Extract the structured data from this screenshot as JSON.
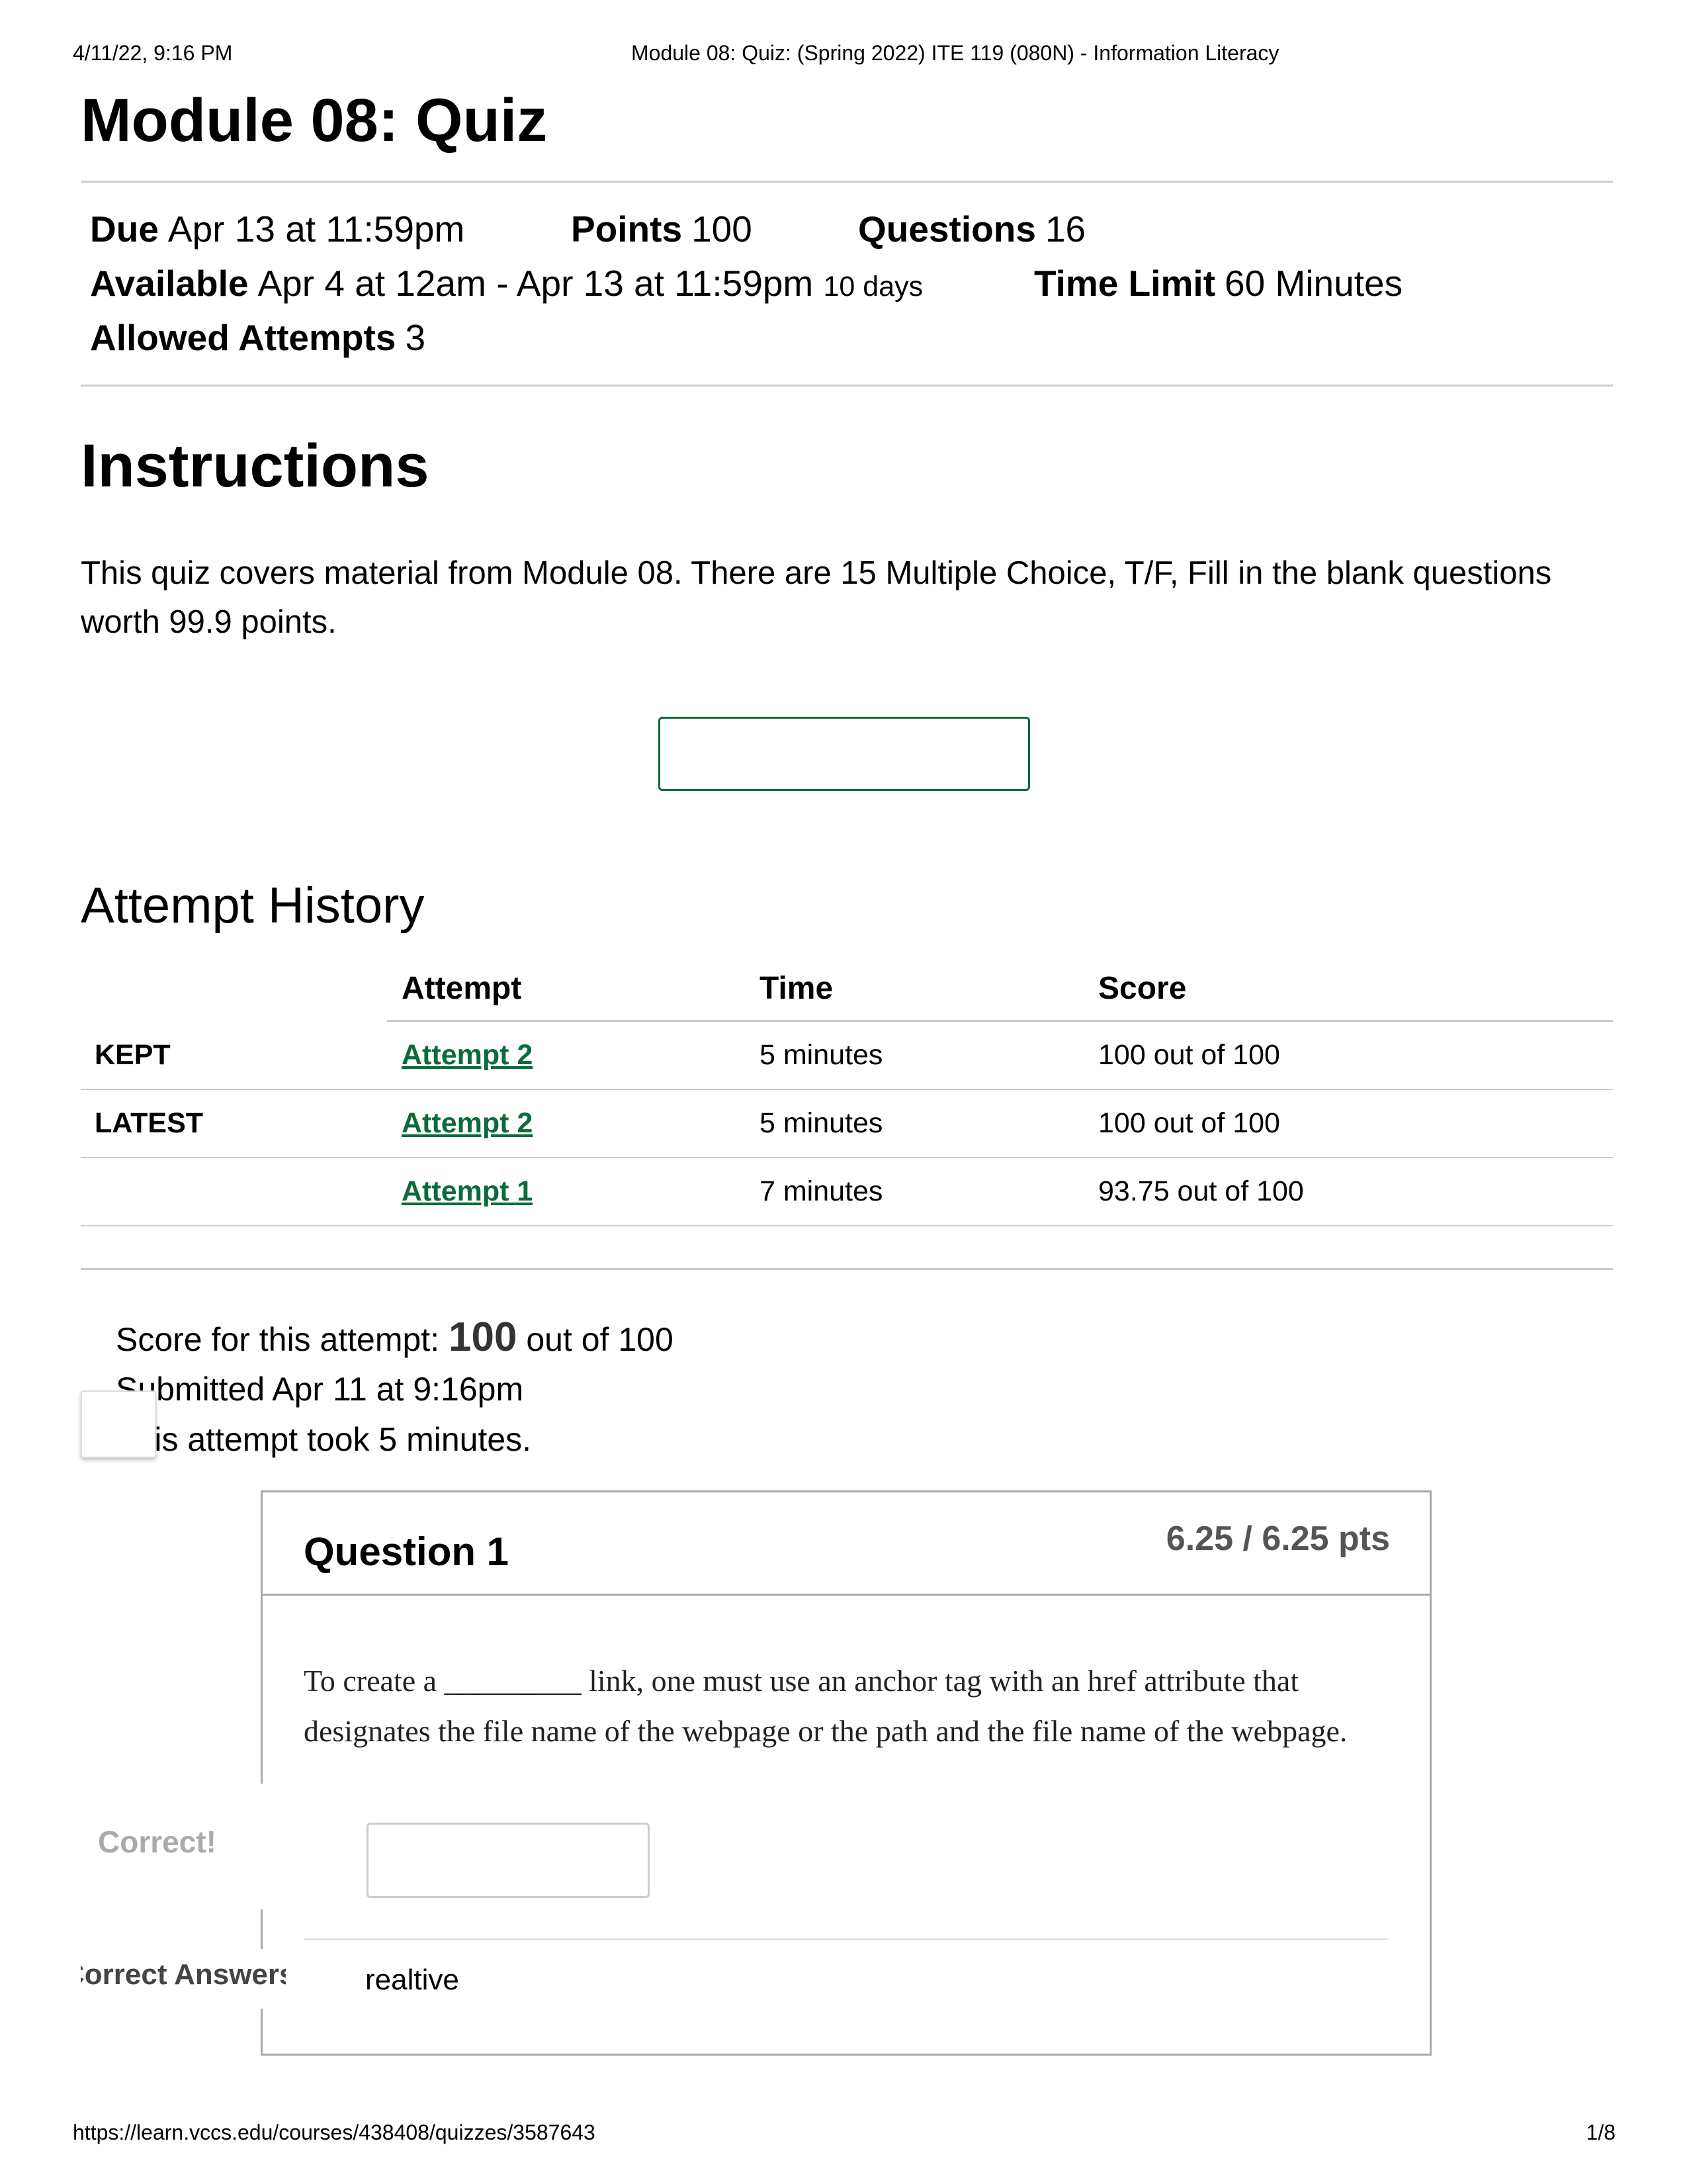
{
  "print_header": {
    "datetime": "4/11/22, 9:16 PM",
    "page_title": "Module 08: Quiz: (Spring 2022) ITE 119 (080N) - Information Literacy"
  },
  "quiz": {
    "title": "Module 08: Quiz",
    "due_label": "Due",
    "due_value": "Apr 13 at 11:59pm",
    "points_label": "Points",
    "points_value": "100",
    "questions_label": "Questions",
    "questions_value": "16",
    "available_label": "Available",
    "available_value": "Apr 4 at 12am - Apr 13 at 11:59pm",
    "available_days": "10 days",
    "time_limit_label": "Time Limit",
    "time_limit_value": "60 Minutes",
    "attempts_label": "Allowed Attempts",
    "attempts_value": "3"
  },
  "instructions": {
    "heading": "Instructions",
    "line1": "This quiz covers material from Module 08. There are 15 Multiple Choice, T/F, Fill in the blank questions",
    "line2": "worth 99.9 points."
  },
  "history": {
    "heading": "Attempt History",
    "columns": [
      "Attempt",
      "Time",
      "Score"
    ],
    "rows": [
      {
        "tag": "KEPT",
        "attempt": "Attempt 2",
        "time": "5 minutes",
        "score": "100 out of 100"
      },
      {
        "tag": "LATEST",
        "attempt": "Attempt 2",
        "time": "5 minutes",
        "score": "100 out of 100"
      },
      {
        "tag": "",
        "attempt": "Attempt 1",
        "time": "7 minutes",
        "score": "93.75 out of 100"
      }
    ]
  },
  "summary": {
    "score_prefix": "Score for this attempt:",
    "score": "100",
    "score_suffix": "out of 100",
    "submitted": "Submitted Apr 11 at 9:16pm",
    "duration": "This attempt took 5 minutes."
  },
  "question1": {
    "title": "Question 1",
    "points": "6.25 / 6.25 pts",
    "text_line1": "To create a _________ link, one must use an anchor tag with an href attribute that",
    "text_line2": "designates the file name of the webpage or the path and the file name of the webpage.",
    "correct_label": "Correct!",
    "correct_answers_label": "Correct Answers",
    "correct_answer": "realtive"
  },
  "print_footer": {
    "url": "https://learn.vccs.edu/courses/438408/quizzes/3587643",
    "page": "1/8"
  },
  "colors": {
    "link": "#0b6b3a",
    "button_border": "#0b6b3a",
    "divider": "#c7cdd1"
  }
}
